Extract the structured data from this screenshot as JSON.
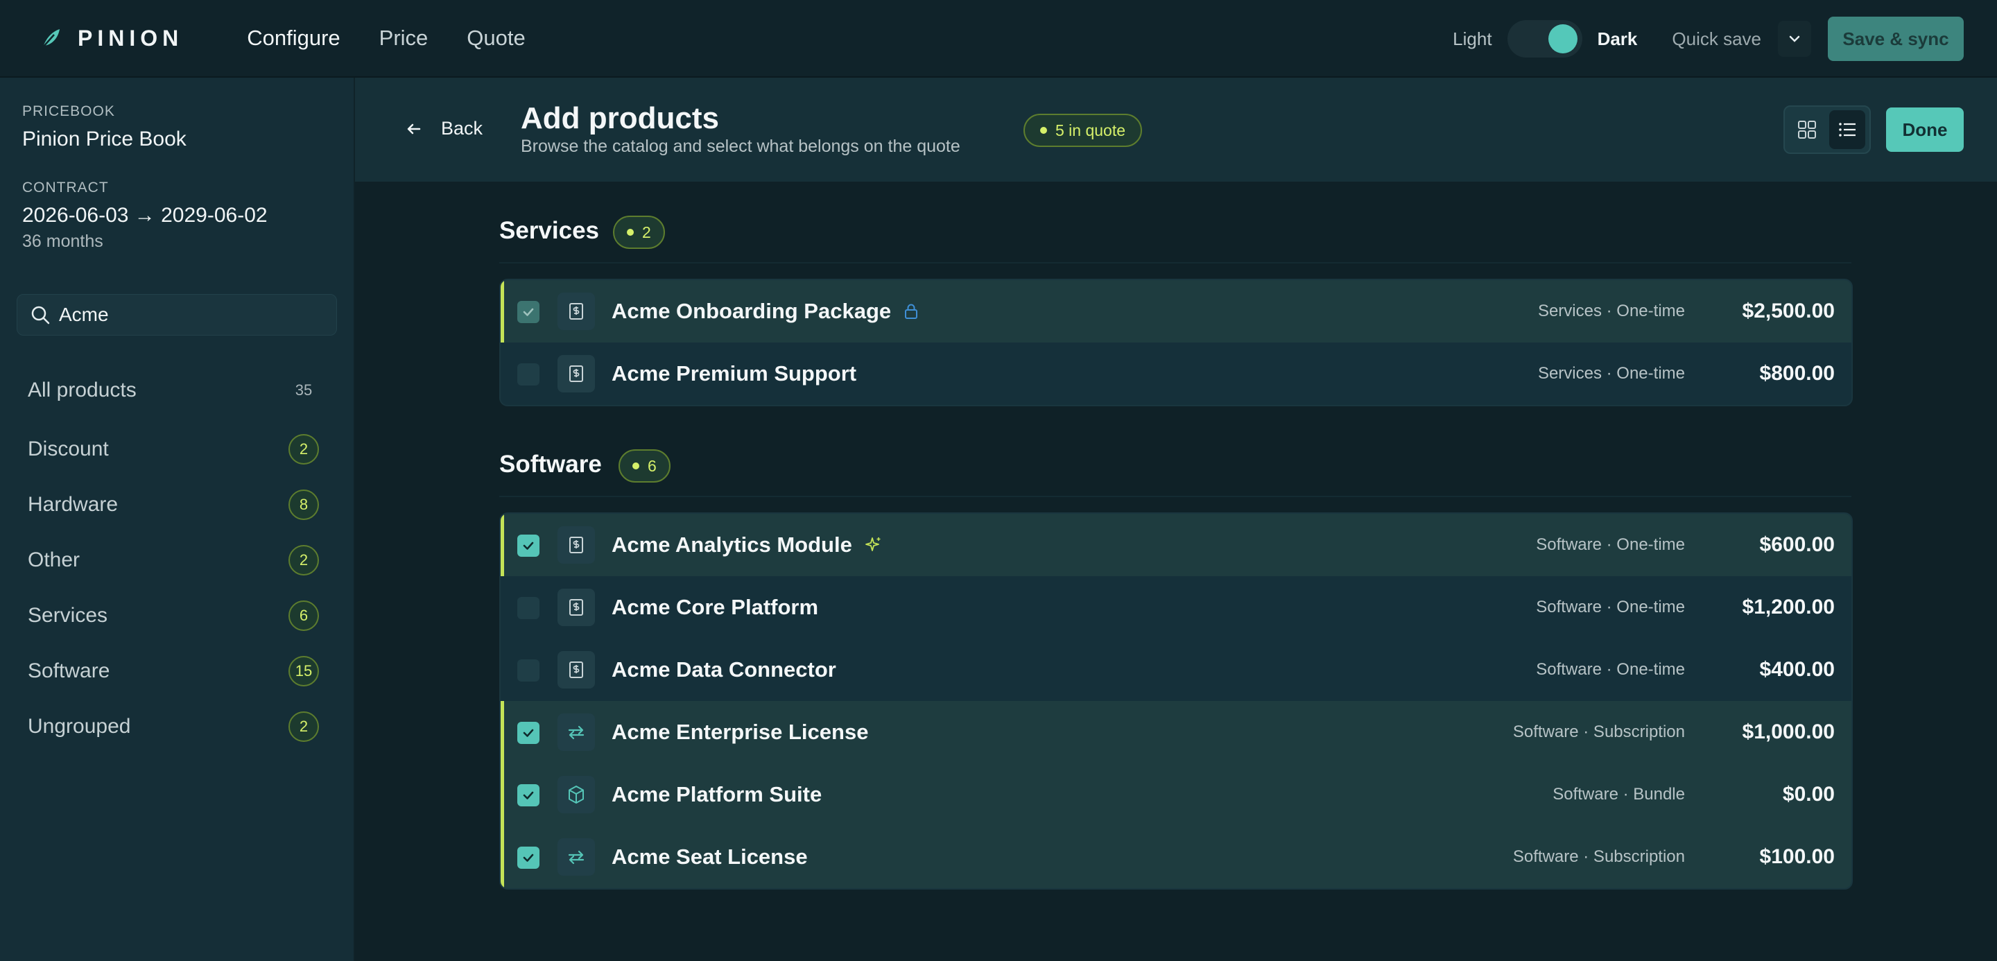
{
  "app": {
    "brand": "PINION",
    "nav": [
      "Configure",
      "Price",
      "Quote"
    ],
    "active_nav": "Configure"
  },
  "topbar": {
    "theme_light_label": "Light",
    "theme_dark_label": "Dark",
    "theme": "dark",
    "quick_save_label": "Quick save",
    "save_sync_label": "Save & sync"
  },
  "sidebar": {
    "pricebook_label": "PRICEBOOK",
    "pricebook_name": "Pinion Price Book",
    "contract_label": "CONTRACT",
    "contract_range": "2026-06-03 → 2029-06-02",
    "contract_term": "36 months",
    "search_value": "Acme",
    "categories": [
      {
        "name": "All products",
        "count": "35"
      },
      {
        "name": "Discount",
        "count": "2"
      },
      {
        "name": "Hardware",
        "count": "8"
      },
      {
        "name": "Other",
        "count": "2"
      },
      {
        "name": "Services",
        "count": "6"
      },
      {
        "name": "Software",
        "count": "15"
      },
      {
        "name": "Ungrouped",
        "count": "2"
      }
    ]
  },
  "header": {
    "back_label": "Back",
    "title": "Add products",
    "subtitle": "Browse the catalog and select what belongs on the quote",
    "in_quote_label": "5 in quote",
    "done_label": "Done",
    "view_mode": "list"
  },
  "groups": [
    {
      "title": "Services",
      "badge": "2",
      "rows": [
        {
          "name": "Acme Onboarding Package",
          "meta": "Services · One-time",
          "price": "$2,500.00",
          "selected": true,
          "locked": true,
          "icon": "dollar-doc-icon"
        },
        {
          "name": "Acme Premium Support",
          "meta": "Services · One-time",
          "price": "$800.00",
          "selected": false,
          "icon": "dollar-doc-icon"
        }
      ]
    },
    {
      "title": "Software",
      "badge": "6",
      "rows": [
        {
          "name": "Acme Analytics Module",
          "meta": "Software · One-time",
          "price": "$600.00",
          "selected": true,
          "sparkle": true,
          "icon": "dollar-doc-icon"
        },
        {
          "name": "Acme Core Platform",
          "meta": "Software · One-time",
          "price": "$1,200.00",
          "selected": false,
          "icon": "dollar-doc-icon"
        },
        {
          "name": "Acme Data Connector",
          "meta": "Software · One-time",
          "price": "$400.00",
          "selected": false,
          "icon": "dollar-doc-icon"
        },
        {
          "name": "Acme Enterprise License",
          "meta": "Software · Subscription",
          "price": "$1,000.00",
          "selected": true,
          "icon": "repeat-icon"
        },
        {
          "name": "Acme Platform Suite",
          "meta": "Software · Bundle",
          "price": "$0.00",
          "selected": true,
          "icon": "cube-icon"
        },
        {
          "name": "Acme Seat License",
          "meta": "Software · Subscription",
          "price": "$100.00",
          "selected": true,
          "icon": "repeat-icon"
        }
      ]
    }
  ],
  "colors": {
    "accent": "#56c8b8",
    "highlight": "#d6f06a",
    "background": "#0f2127"
  }
}
